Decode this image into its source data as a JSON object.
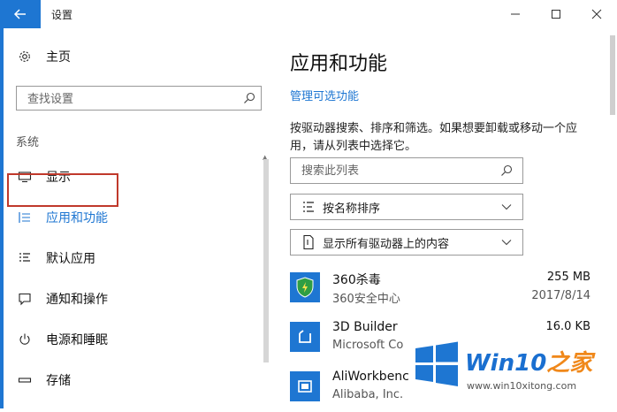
{
  "window": {
    "title": "设置",
    "back_label": "←",
    "minimize": "—",
    "maximize": "☐",
    "close": "✕"
  },
  "sidebar": {
    "home_label": "主页",
    "search_placeholder": "查找设置",
    "section_label": "系统",
    "items": [
      {
        "label": "显示",
        "icon": "monitor-icon"
      },
      {
        "label": "应用和功能",
        "icon": "list-icon",
        "selected": true
      },
      {
        "label": "默认应用",
        "icon": "default-apps-icon"
      },
      {
        "label": "通知和操作",
        "icon": "notification-icon"
      },
      {
        "label": "电源和睡眠",
        "icon": "power-icon"
      },
      {
        "label": "存储",
        "icon": "storage-icon"
      }
    ]
  },
  "main": {
    "title": "应用和功能",
    "manage_link": "管理可选功能",
    "description": "按驱动器搜索、排序和筛选。如果想要卸载或移动一个应用，请从列表中选择它。",
    "search_placeholder": "搜索此列表",
    "sort_label": "按名称排序",
    "filter_label": "显示所有驱动器上的内容",
    "apps": [
      {
        "name": "360杀毒",
        "publisher": "360安全中心",
        "size": "255 MB",
        "date": "2017/8/14",
        "icon": "360-shield-icon"
      },
      {
        "name": "3D Builder",
        "publisher": "Microsoft Co",
        "size": "16.0 KB",
        "date": "",
        "icon": "3d-builder-icon"
      },
      {
        "name": "AliWorkbenc",
        "publisher": "Alibaba, Inc.",
        "size": "",
        "date": "",
        "icon": "aliworkbench-icon"
      }
    ]
  },
  "watermark": {
    "brand_prefix": "Win10",
    "brand_suffix": "之家",
    "url": "www.win10xitong.com"
  },
  "colors": {
    "accent": "#1e76d2",
    "highlight_border": "#c0392b",
    "watermark_orange": "#f0881a",
    "shield_green": "#2f9e44"
  }
}
